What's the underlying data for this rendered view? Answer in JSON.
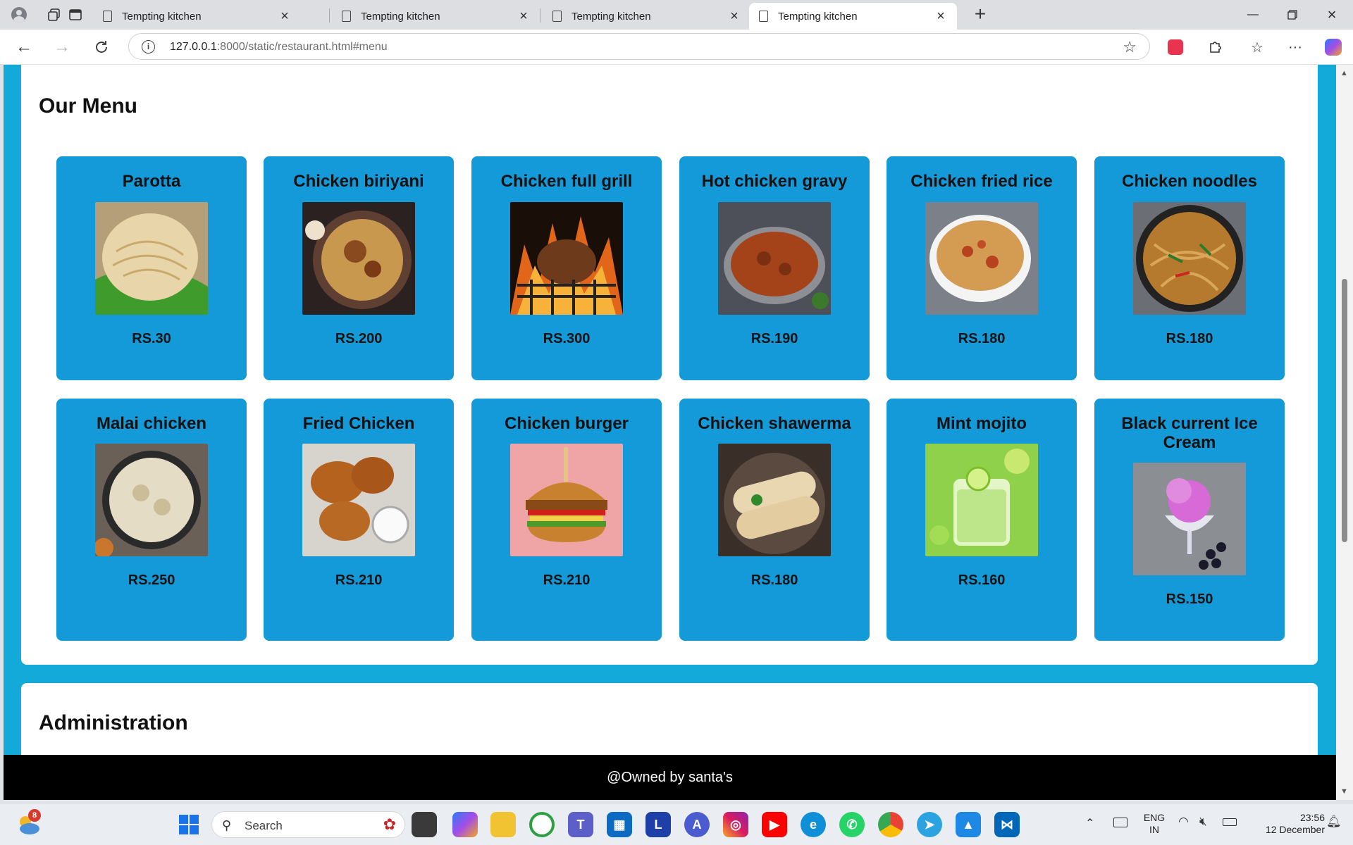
{
  "browser": {
    "tabs": [
      {
        "title": "Tempting kitchen"
      },
      {
        "title": "Tempting kitchen"
      },
      {
        "title": "Tempting kitchen"
      },
      {
        "title": "Tempting kitchen"
      }
    ],
    "url_host": "127.0.0.1",
    "url_rest": ":8000/static/restaurant.html#menu"
  },
  "page": {
    "menu_title": "Our Menu",
    "admin_title": "Administration",
    "footer": "@Owned by santa's"
  },
  "menu": {
    "items": [
      {
        "name": "Parotta",
        "price": "RS.30"
      },
      {
        "name": "Chicken biriyani",
        "price": "RS.200"
      },
      {
        "name": "Chicken full grill",
        "price": "RS.300"
      },
      {
        "name": "Hot chicken gravy",
        "price": "RS.190"
      },
      {
        "name": "Chicken fried rice",
        "price": "RS.180"
      },
      {
        "name": "Chicken noodles",
        "price": "RS.180"
      },
      {
        "name": "Malai chicken",
        "price": "RS.250"
      },
      {
        "name": "Fried Chicken",
        "price": "RS.210"
      },
      {
        "name": "Chicken burger",
        "price": "RS.210"
      },
      {
        "name": "Chicken shawerma",
        "price": "RS.180"
      },
      {
        "name": "Mint mojito",
        "price": "RS.160"
      },
      {
        "name": "Black current Ice Cream",
        "price": "RS.150"
      }
    ]
  },
  "taskbar": {
    "weather_badge": "8",
    "search_placeholder": "Search",
    "lang_top": "ENG",
    "lang_bottom": "IN",
    "time": "23:56",
    "date": "12 December"
  },
  "colors": {
    "page_bg": "#13a9d8",
    "card_bg": "#149ad9",
    "footer_bg": "#000000"
  }
}
